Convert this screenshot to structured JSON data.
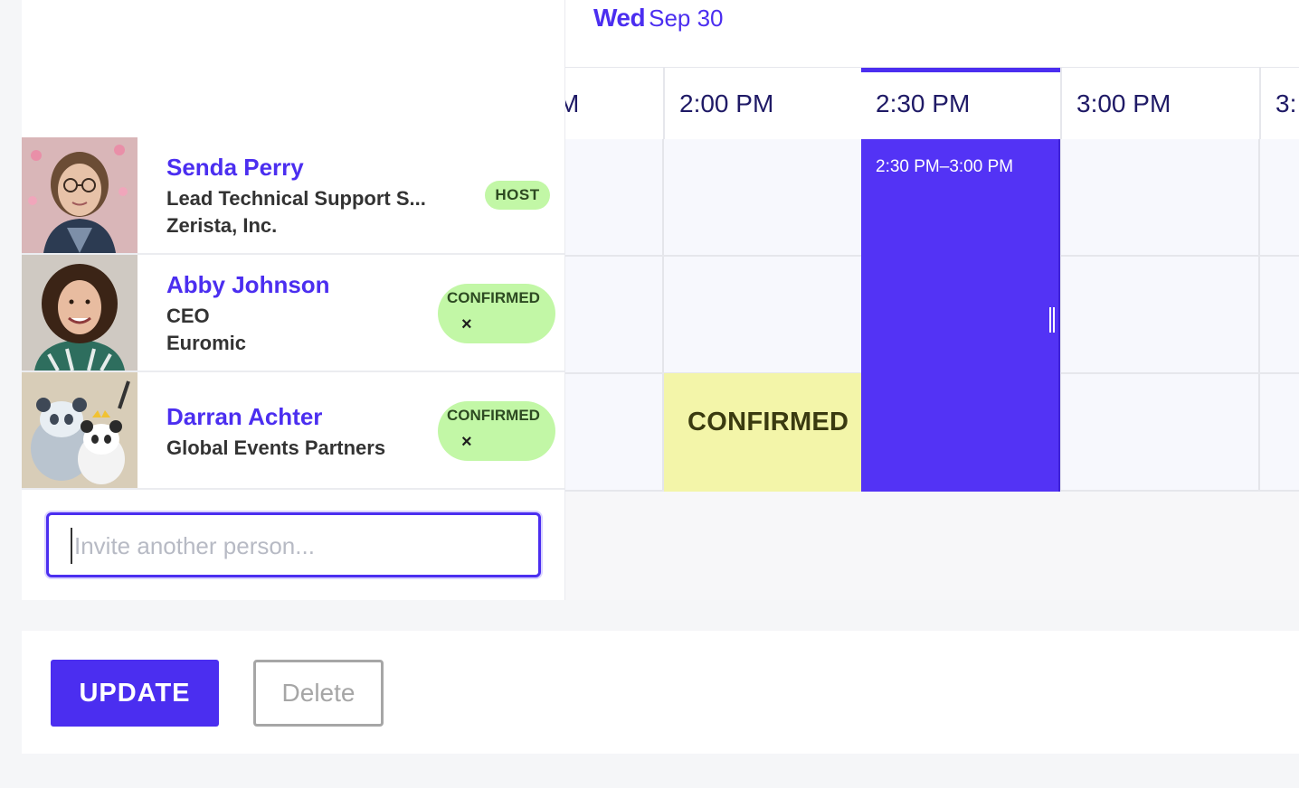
{
  "calendar": {
    "day_of_week": "Wed",
    "month_day": "Sep 30",
    "time_slots": [
      {
        "label": "M",
        "active": false
      },
      {
        "label": "2:00 PM",
        "active": false
      },
      {
        "label": "2:30 PM",
        "active": true
      },
      {
        "label": "3:00 PM",
        "active": false
      },
      {
        "label": "3:",
        "active": false
      }
    ],
    "event_time": "2:30 PM–3:00 PM",
    "confirmed_block_label": "CONFIRMED"
  },
  "attendees": [
    {
      "name": "Senda Perry",
      "title": "Lead Technical Support S...",
      "company": "Zerista, Inc.",
      "status": "HOST"
    },
    {
      "name": "Abby Johnson",
      "title": "CEO",
      "company": "Euromic",
      "status": "CONFIRMED",
      "remove": "×"
    },
    {
      "name": "Darran Achter",
      "title": "Global Events Partners",
      "status": "CONFIRMED",
      "remove": "×"
    }
  ],
  "invite": {
    "placeholder": "Invite another person..."
  },
  "actions": {
    "update_label": "UPDATE",
    "delete_label": "Delete"
  },
  "colors": {
    "accent": "#4b2ef0",
    "event": "#5333f5",
    "badge": "#c2f7a6",
    "confirmed_block": "#f3f5a9"
  }
}
